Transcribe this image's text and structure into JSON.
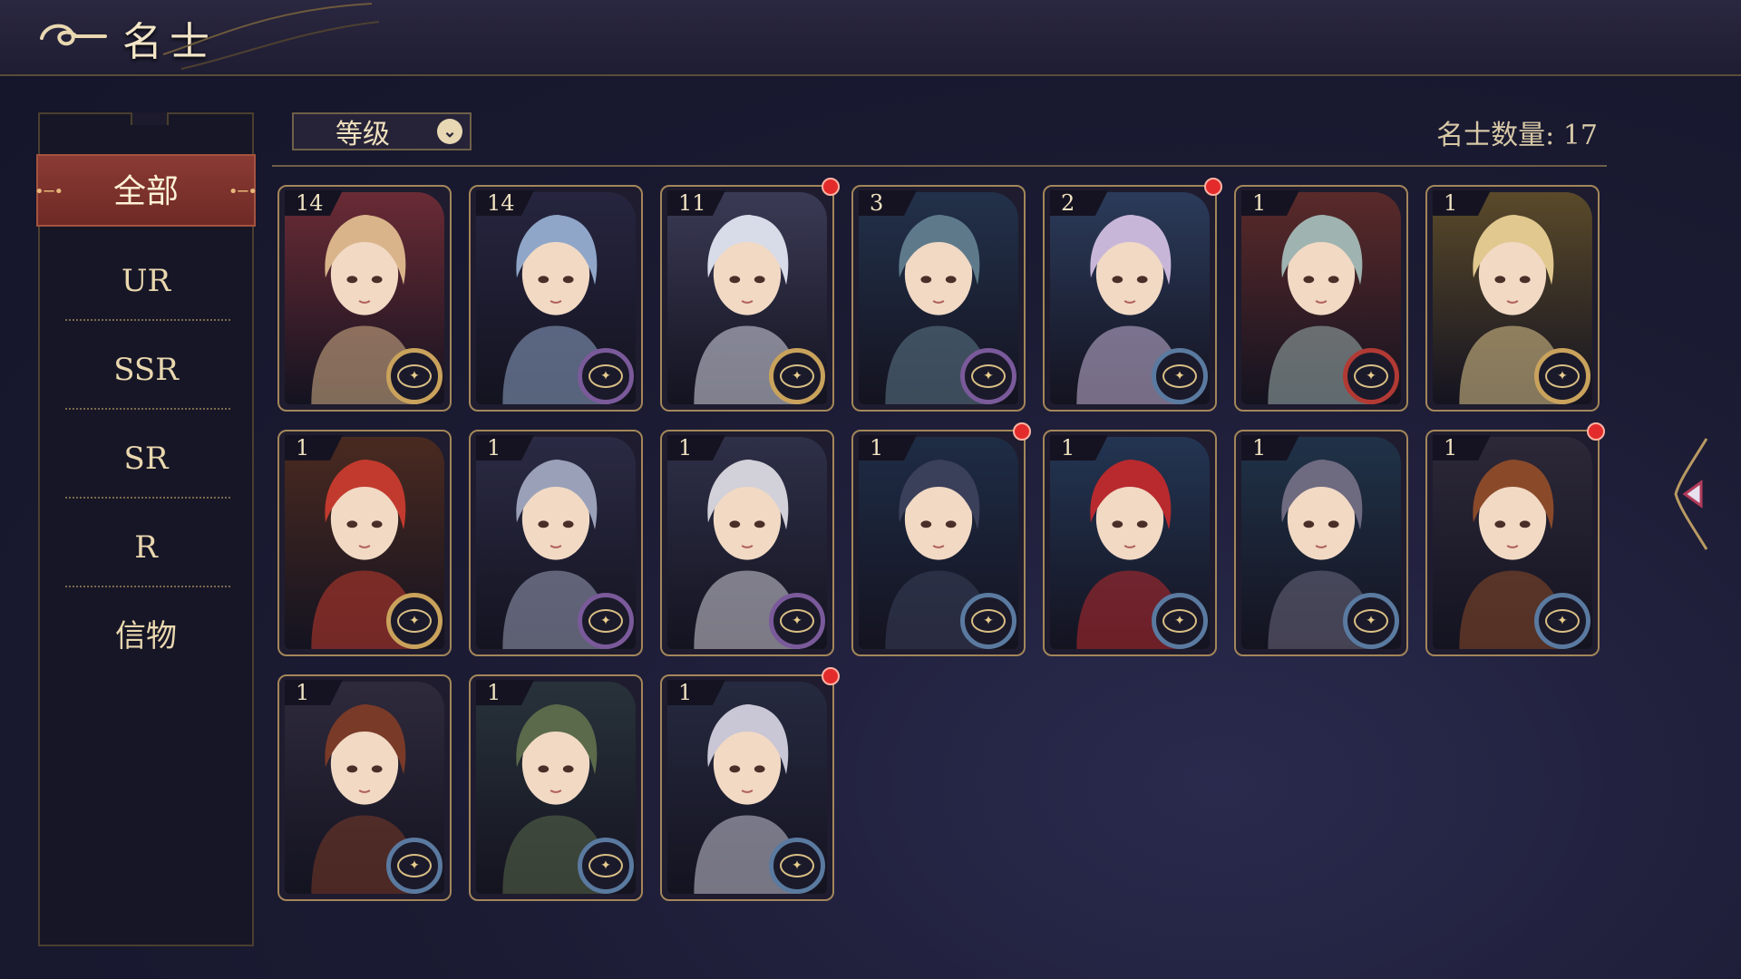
{
  "header": {
    "title": "名士"
  },
  "sidebar": {
    "tabs": [
      {
        "label": "全部",
        "active": true
      },
      {
        "label": "UR"
      },
      {
        "label": "SSR"
      },
      {
        "label": "SR"
      },
      {
        "label": "R"
      },
      {
        "label": "信物"
      }
    ]
  },
  "toolbar": {
    "sort_label": "等级",
    "count_text": "名士数量: 17"
  },
  "cards": [
    {
      "level": "14",
      "frame": "gold",
      "theme": [
        "#6a2b35",
        "#d9b48a"
      ],
      "new": false
    },
    {
      "level": "14",
      "frame": "purple",
      "theme": [
        "#26253f",
        "#8fa6c8"
      ],
      "new": false
    },
    {
      "level": "11",
      "frame": "gold",
      "theme": [
        "#3a3a55",
        "#d8dbe8"
      ],
      "new": true
    },
    {
      "level": "3",
      "frame": "purple",
      "theme": [
        "#22314a",
        "#5e7a8a"
      ],
      "new": false
    },
    {
      "level": "2",
      "frame": "blue",
      "theme": [
        "#2b3b5a",
        "#c8b6d8"
      ],
      "new": true
    },
    {
      "level": "1",
      "frame": "red",
      "theme": [
        "#5a2a2a",
        "#9fb3b0"
      ],
      "new": false
    },
    {
      "level": "1",
      "frame": "gold",
      "theme": [
        "#5a4a2a",
        "#e0c88e"
      ],
      "new": false
    },
    {
      "level": "1",
      "frame": "gold",
      "theme": [
        "#4a2a20",
        "#c23a2e"
      ],
      "new": false
    },
    {
      "level": "1",
      "frame": "purple",
      "theme": [
        "#2a2a44",
        "#9aa0b8"
      ],
      "new": false
    },
    {
      "level": "1",
      "frame": "purple",
      "theme": [
        "#2e3048",
        "#d2d0d8"
      ],
      "new": false
    },
    {
      "level": "1",
      "frame": "blue",
      "theme": [
        "#1e2c45",
        "#3a3f5a"
      ],
      "new": true
    },
    {
      "level": "1",
      "frame": "blue",
      "theme": [
        "#233552",
        "#b82a2e"
      ],
      "new": false
    },
    {
      "level": "1",
      "frame": "blue",
      "theme": [
        "#203248",
        "#6e6a80"
      ],
      "new": false
    },
    {
      "level": "1",
      "frame": "blue",
      "theme": [
        "#2c2838",
        "#8a4a2a"
      ],
      "new": true
    },
    {
      "level": "1",
      "frame": "blue",
      "theme": [
        "#2e2a3c",
        "#7a3a28"
      ],
      "new": false
    },
    {
      "level": "1",
      "frame": "blue",
      "theme": [
        "#28323a",
        "#5a6a4a"
      ],
      "new": false
    },
    {
      "level": "1",
      "frame": "blue",
      "theme": [
        "#262a40",
        "#c9c6d6"
      ],
      "new": true
    }
  ],
  "colors": {
    "gold": "#c9a25c",
    "purple": "#7a5a9a",
    "blue": "#5a7aa0",
    "red": "#b23a34",
    "active_tab": "#7a302b"
  }
}
